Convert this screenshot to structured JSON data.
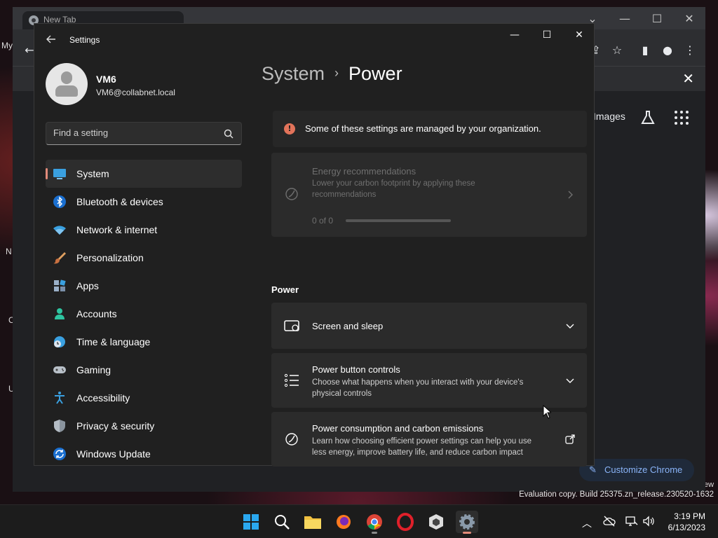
{
  "desktop": {
    "icon_labels": [
      "My",
      "N",
      "C",
      "U"
    ],
    "watermark": "Evaluation copy. Build 25375.zn_release.230520-1632",
    "edge_text": "ew"
  },
  "chrome": {
    "tab_title": "New Tab",
    "images_link": "Images",
    "customize_label": "Customize Chrome"
  },
  "settings": {
    "window_title": "Settings",
    "user": {
      "name": "VM6",
      "email": "VM6@collabnet.local"
    },
    "search_placeholder": "Find a setting",
    "nav": [
      {
        "label": "System",
        "icon": "monitor-icon",
        "active": true
      },
      {
        "label": "Bluetooth & devices",
        "icon": "bluetooth-icon"
      },
      {
        "label": "Network & internet",
        "icon": "wifi-icon"
      },
      {
        "label": "Personalization",
        "icon": "brush-icon"
      },
      {
        "label": "Apps",
        "icon": "apps-icon"
      },
      {
        "label": "Accounts",
        "icon": "person-icon"
      },
      {
        "label": "Time & language",
        "icon": "globe-clock-icon"
      },
      {
        "label": "Gaming",
        "icon": "gamepad-icon"
      },
      {
        "label": "Accessibility",
        "icon": "accessibility-icon"
      },
      {
        "label": "Privacy & security",
        "icon": "shield-icon"
      },
      {
        "label": "Windows Update",
        "icon": "update-icon"
      }
    ],
    "breadcrumb": {
      "parent": "System",
      "separator": "›",
      "current": "Power"
    },
    "managed_banner": "Some of these settings are managed by your organization.",
    "energy_card": {
      "title": "Energy recommendations",
      "description": "Lower your carbon footprint by applying these recommendations",
      "progress_text": "0 of 0",
      "progress": 0
    },
    "section_power": "Power",
    "cards": [
      {
        "title": "Screen and sleep",
        "description": "",
        "icon": "screen-sleep-icon",
        "action": "chevron-down-icon"
      },
      {
        "title": "Power button controls",
        "description": "Choose what happens when you interact with your device's physical controls",
        "icon": "list-icon",
        "action": "chevron-down-icon"
      },
      {
        "title": "Power consumption and carbon emissions",
        "description": "Learn how choosing efficient power settings can help you use less energy, improve battery life, and reduce carbon impact",
        "icon": "leaf-icon",
        "action": "external-link-icon"
      }
    ]
  },
  "taskbar": {
    "time": "3:19 PM",
    "date": "6/13/2023"
  },
  "colors": {
    "accent": "#e28b7a",
    "window_bg": "#202020",
    "card_bg": "#2b2b2b"
  }
}
